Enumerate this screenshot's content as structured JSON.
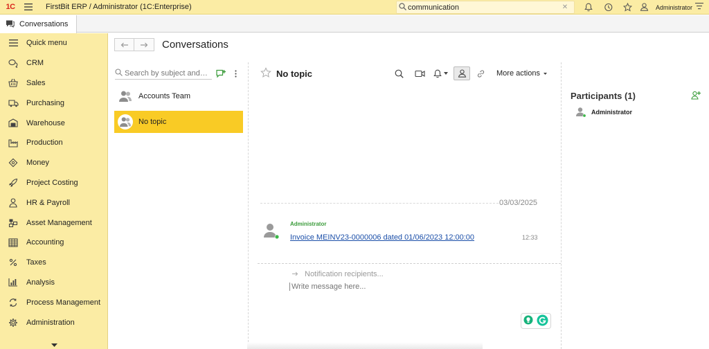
{
  "app": {
    "logo": "1С",
    "title": "FirstBit ERP / Administrator  (1C:Enterprise)",
    "search_value": "communication",
    "user": "Administrator"
  },
  "tabs": [
    {
      "label": "Conversations",
      "icon": "chat-icon"
    }
  ],
  "sidebar": {
    "items": [
      {
        "label": "Quick menu",
        "icon": "list-icon"
      },
      {
        "label": "CRM",
        "icon": "chat-bubbles-icon"
      },
      {
        "label": "Sales",
        "icon": "basket-icon"
      },
      {
        "label": "Purchasing",
        "icon": "truck-icon"
      },
      {
        "label": "Warehouse",
        "icon": "warehouse-icon"
      },
      {
        "label": "Production",
        "icon": "factory-icon"
      },
      {
        "label": "Money",
        "icon": "money-icon"
      },
      {
        "label": "Project Costing",
        "icon": "rocket-icon"
      },
      {
        "label": "HR & Payroll",
        "icon": "person-icon"
      },
      {
        "label": "Asset Management",
        "icon": "asset-icon"
      },
      {
        "label": "Accounting",
        "icon": "ledger-icon"
      },
      {
        "label": "Taxes",
        "icon": "percent-icon"
      },
      {
        "label": "Analysis",
        "icon": "bar-chart-icon"
      },
      {
        "label": "Process Management",
        "icon": "cycle-icon"
      },
      {
        "label": "Administration",
        "icon": "gear-icon"
      }
    ]
  },
  "page": {
    "title": "Conversations"
  },
  "conversations": {
    "search_placeholder": "Search by subject and…",
    "items": [
      {
        "label": "Accounts Team",
        "selected": false
      },
      {
        "label": "No topic",
        "selected": true
      }
    ]
  },
  "chat": {
    "title": "No topic",
    "more_actions": "More actions",
    "date": "03/03/2025",
    "message": {
      "author": "Administrator",
      "text": "Invoice MEINV23-0000006 dated 01/06/2023 12:00:00",
      "time": "12:33"
    },
    "recipients_placeholder": "Notification recipients...",
    "write_placeholder": "Write message here..."
  },
  "participants": {
    "title": "Participants (1)",
    "items": [
      {
        "name": "Administrator",
        "online": true
      }
    ]
  },
  "colors": {
    "sidebar_bg": "#fbeca4",
    "selected_bg": "#f9cb25",
    "green": "#3a9b3a",
    "link": "#1a4ea8"
  }
}
